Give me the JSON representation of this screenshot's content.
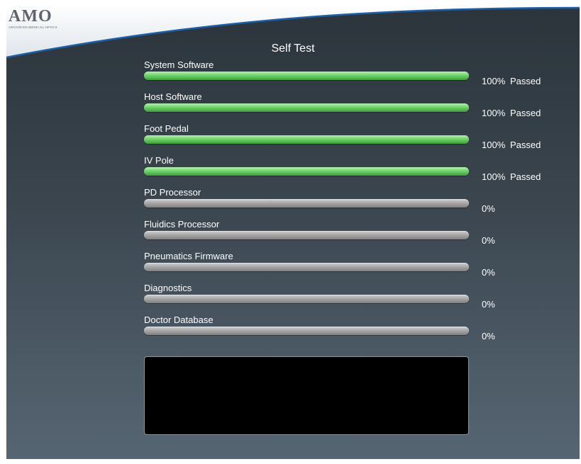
{
  "brand": {
    "logo_text": "AMO",
    "logo_subtitle": "ADVANCED MEDICAL OPTICS",
    "accent_color": "#1f5fa8"
  },
  "page": {
    "title": "Self Test"
  },
  "tests": [
    {
      "label": "System Software",
      "progress": 100,
      "percent_text": "100%",
      "status": "Passed"
    },
    {
      "label": "Host Software",
      "progress": 100,
      "percent_text": "100%",
      "status": "Passed"
    },
    {
      "label": "Foot Pedal",
      "progress": 100,
      "percent_text": "100%",
      "status": "Passed"
    },
    {
      "label": "IV Pole",
      "progress": 100,
      "percent_text": "100%",
      "status": "Passed"
    },
    {
      "label": "PD Processor",
      "progress": 0,
      "percent_text": "0%",
      "status": ""
    },
    {
      "label": "Fluidics Processor",
      "progress": 0,
      "percent_text": "0%",
      "status": ""
    },
    {
      "label": "Pneumatics Firmware",
      "progress": 0,
      "percent_text": "0%",
      "status": ""
    },
    {
      "label": "Diagnostics",
      "progress": 0,
      "percent_text": "0%",
      "status": ""
    },
    {
      "label": "Doctor Database",
      "progress": 0,
      "percent_text": "0%",
      "status": ""
    }
  ],
  "colors": {
    "passed_fill": "#5cc157",
    "pending_track": "#9a9a9a"
  }
}
